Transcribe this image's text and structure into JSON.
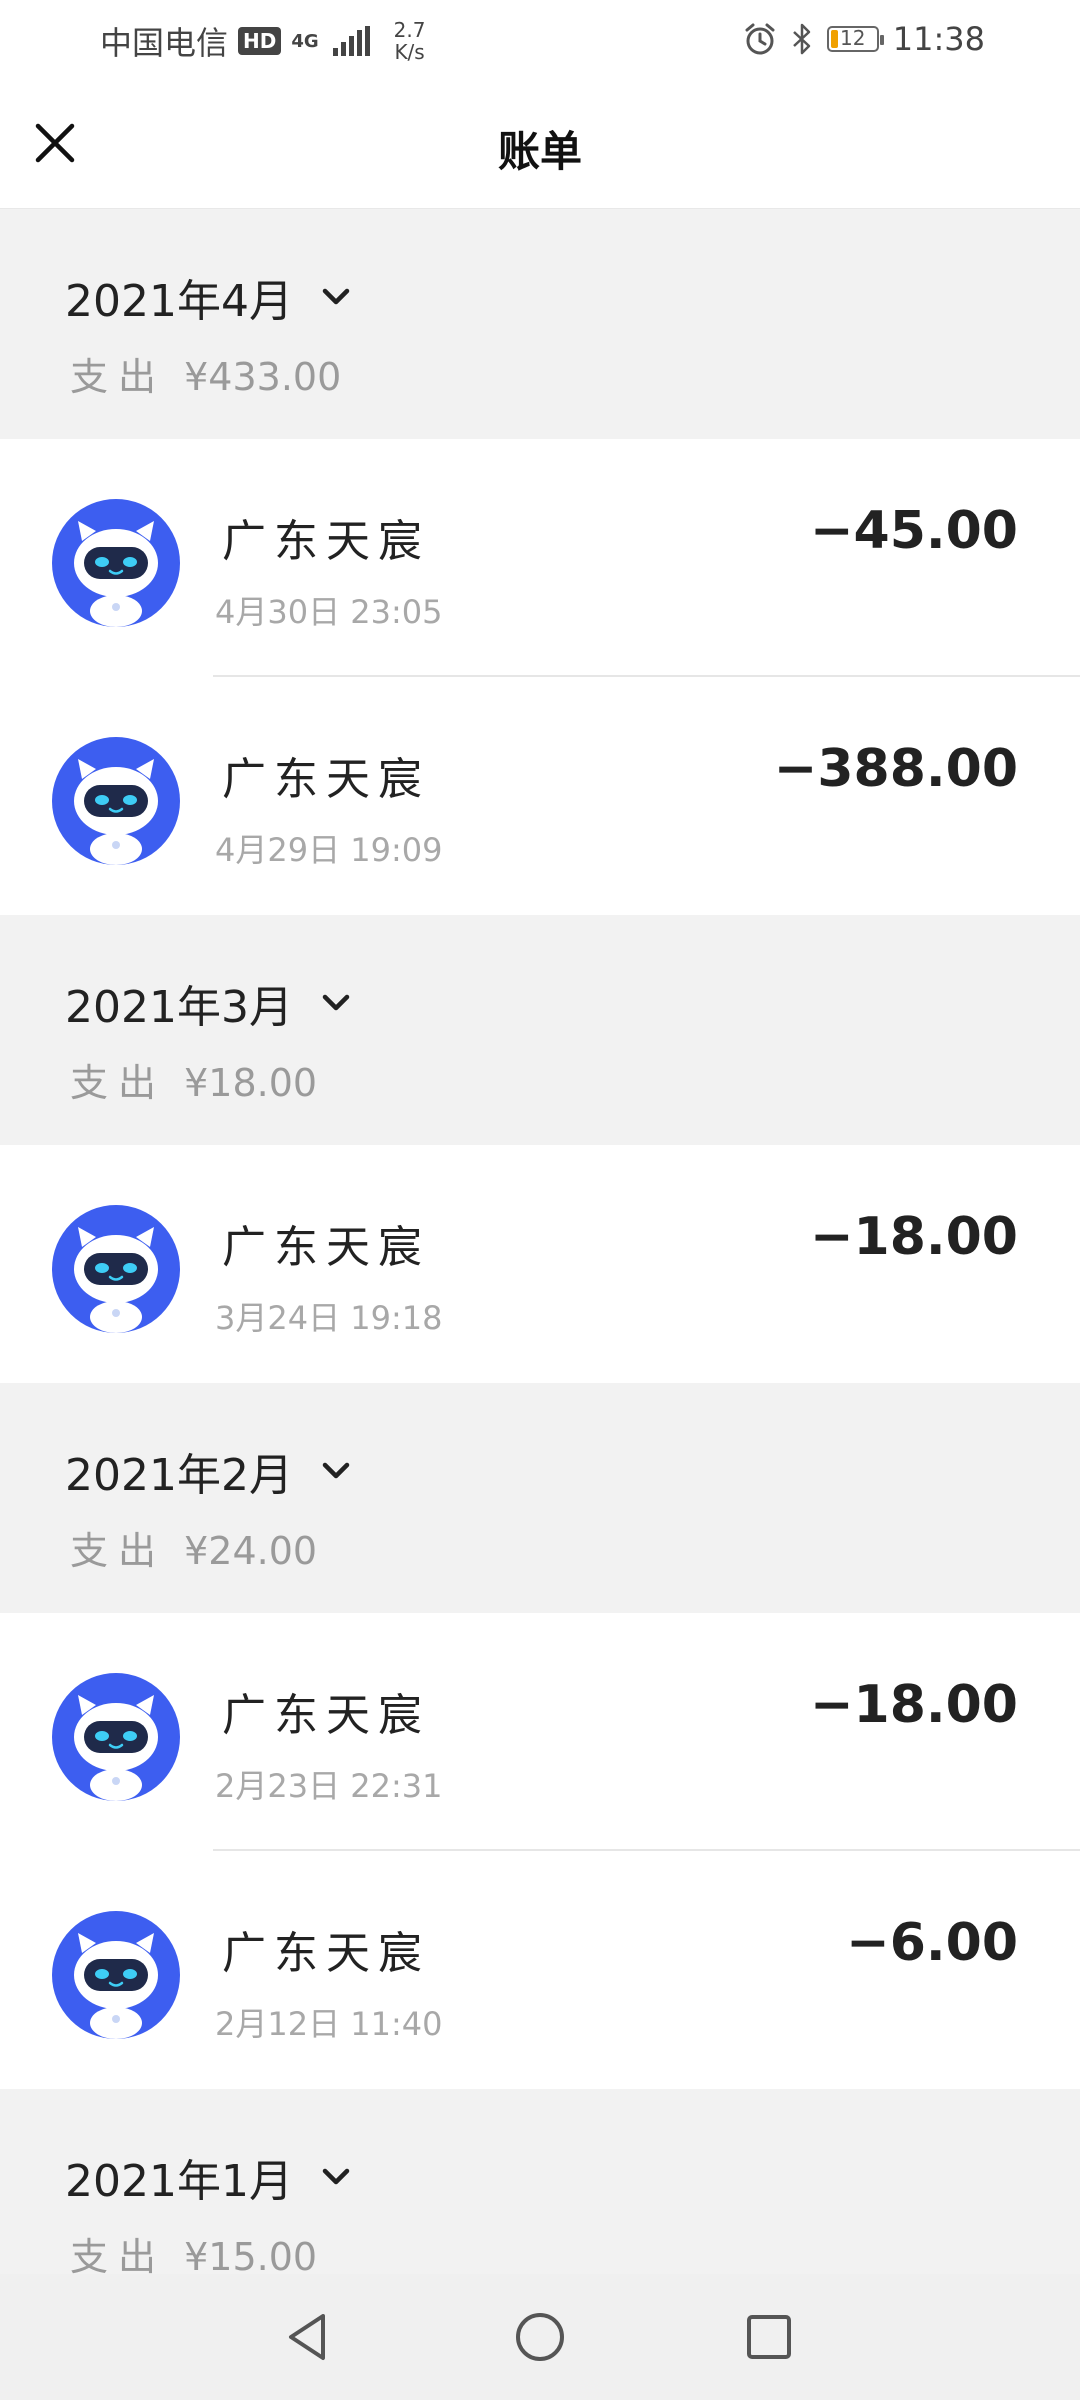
{
  "status_bar": {
    "carrier": "中国电信",
    "hd": "HD",
    "network": "4G",
    "speed_value": "2.7",
    "speed_unit": "K/s",
    "battery": "12",
    "time": "11:38"
  },
  "header": {
    "title": "账单"
  },
  "months": [
    {
      "title": "2021年4月",
      "summary_label": "支出",
      "summary_amount": "¥433.00",
      "items": [
        {
          "merchant": "广东天宸",
          "datetime": "4月30日  23:05",
          "amount": "−45.00"
        },
        {
          "merchant": "广东天宸",
          "datetime": "4月29日  19:09",
          "amount": "−388.00"
        }
      ]
    },
    {
      "title": "2021年3月",
      "summary_label": "支出",
      "summary_amount": "¥18.00",
      "items": [
        {
          "merchant": "广东天宸",
          "datetime": "3月24日  19:18",
          "amount": "−18.00"
        }
      ]
    },
    {
      "title": "2021年2月",
      "summary_label": "支出",
      "summary_amount": "¥24.00",
      "items": [
        {
          "merchant": "广东天宸",
          "datetime": "2月23日  22:31",
          "amount": "−18.00"
        },
        {
          "merchant": "广东天宸",
          "datetime": "2月12日  11:40",
          "amount": "−6.00"
        }
      ]
    },
    {
      "title": "2021年1月",
      "summary_label": "支出",
      "summary_amount": "¥15.00",
      "items": []
    }
  ],
  "colors": {
    "avatar_blue": "#3d5ef0",
    "background": "#f2f2f2",
    "muted_text": "#9a9a9a"
  },
  "icons": {
    "close": "close-icon",
    "chevron": "chevron-down-icon",
    "avatar": "robot-avatar-icon",
    "back": "back-triangle-icon",
    "home": "home-circle-icon",
    "recents": "recents-square-icon"
  }
}
